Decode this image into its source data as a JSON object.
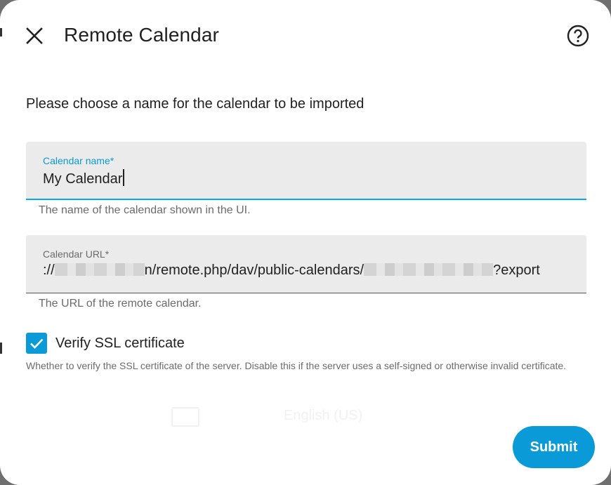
{
  "dialog": {
    "title": "Remote Calendar",
    "description": "Please choose a name for the calendar to be imported"
  },
  "name_field": {
    "label": "Calendar name*",
    "value": "My Calendar",
    "helper": "The name of the calendar shown in the UI."
  },
  "url_field": {
    "label": "Calendar URL*",
    "value_prefix": "://",
    "value_mid_tail": "n",
    "value_path": "/remote.php/dav/public-calendars/",
    "value_suffix": "?export",
    "helper": "The URL of the remote calendar."
  },
  "verify_ssl": {
    "label": "Verify SSL certificate",
    "checked": true,
    "helper": "Whether to verify the SSL certificate of the server. Disable this if the server uses a self-signed or otherwise invalid certificate."
  },
  "background": {
    "language": "English (US)"
  },
  "actions": {
    "submit_label": "Submit"
  },
  "icons": [
    "close-icon",
    "help-icon",
    "check-icon"
  ],
  "colors": {
    "accent": "#0a9ad8",
    "field_bg": "#ebebeb"
  }
}
